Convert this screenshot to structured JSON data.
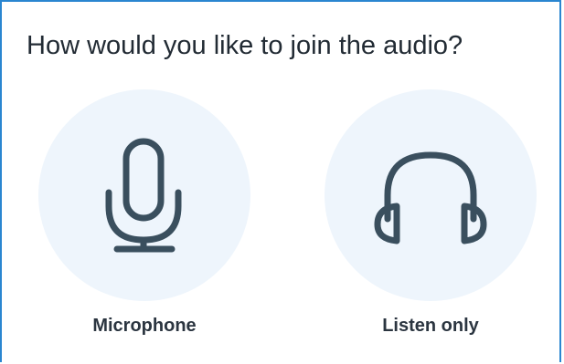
{
  "dialog": {
    "title": "How would you like to join the audio?",
    "options": [
      {
        "label": "Microphone",
        "icon": "microphone-icon"
      },
      {
        "label": "Listen only",
        "icon": "headphones-icon"
      }
    ]
  },
  "colors": {
    "border": "#2a86d0",
    "circle_bg": "#eef5fc",
    "icon": "#3a4f5e",
    "text": "#222b34"
  }
}
